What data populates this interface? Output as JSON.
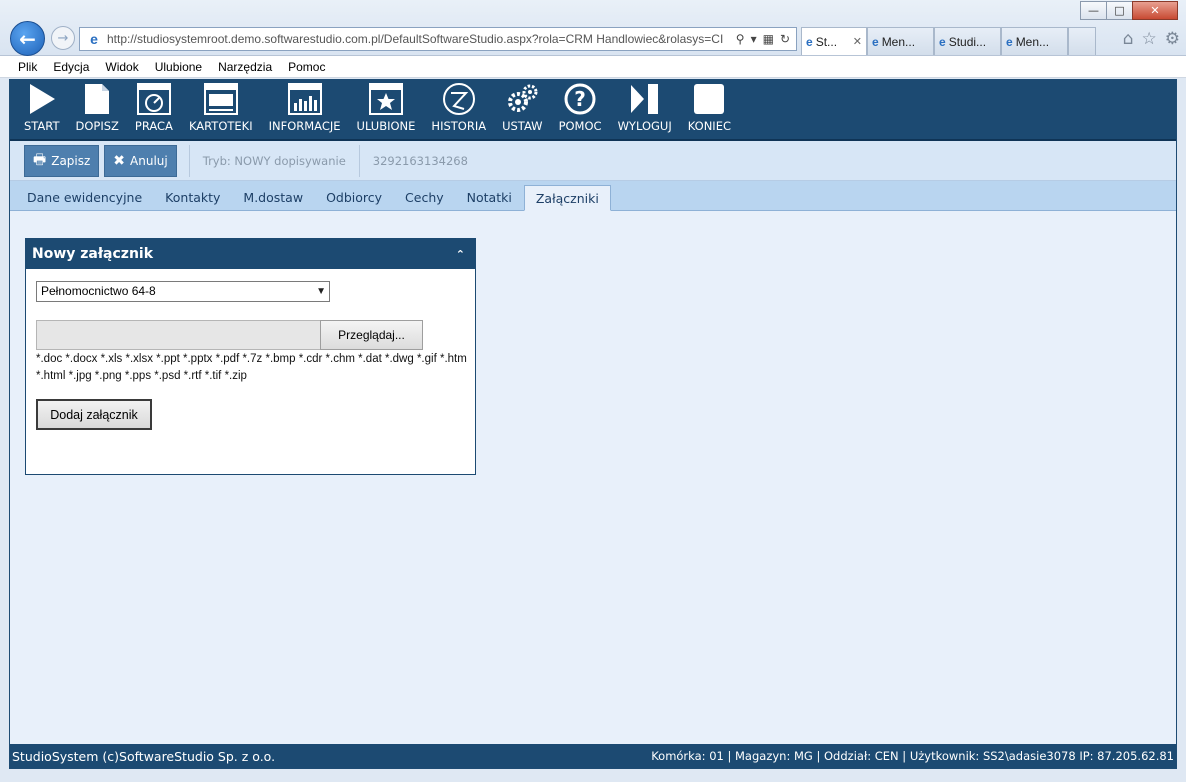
{
  "browser": {
    "url": "http://studiosystemroot.demo.softwarestudio.com.pl/DefaultSoftwareStudio.aspx?rola=CRM Handlowiec&rolasys=CI",
    "tabs": [
      {
        "label": "St...",
        "active": true
      },
      {
        "label": "Men...",
        "active": false
      },
      {
        "label": "Studi...",
        "active": false
      },
      {
        "label": "Men...",
        "active": false
      }
    ],
    "menu": [
      "Plik",
      "Edycja",
      "Widok",
      "Ulubione",
      "Narzędzia",
      "Pomoc"
    ]
  },
  "toolbar": {
    "items": [
      {
        "label": "START",
        "icon": "play-icon"
      },
      {
        "label": "DOPISZ",
        "icon": "document-icon"
      },
      {
        "label": "PRACA",
        "icon": "gauge-icon"
      },
      {
        "label": "KARTOTEKI",
        "icon": "window-icon"
      },
      {
        "label": "INFORMACJE",
        "icon": "chart-icon"
      },
      {
        "label": "ULUBIONE",
        "icon": "star-icon"
      },
      {
        "label": "HISTORIA",
        "icon": "history-icon"
      },
      {
        "label": "USTAW",
        "icon": "gears-icon"
      },
      {
        "label": "POMOC",
        "icon": "help-icon"
      },
      {
        "label": "WYLOGUJ",
        "icon": "logout-icon"
      },
      {
        "label": "KONIEC",
        "icon": "stop-icon"
      }
    ]
  },
  "actions": {
    "save_label": "Zapisz",
    "cancel_label": "Anuluj",
    "mode_text": "Tryb: NOWY dopisywanie",
    "record_id": "3292163134268"
  },
  "tabs": [
    {
      "label": "Dane ewidencyjne",
      "active": false
    },
    {
      "label": "Kontakty",
      "active": false
    },
    {
      "label": "M.dostaw",
      "active": false
    },
    {
      "label": "Odbiorcy",
      "active": false
    },
    {
      "label": "Cechy",
      "active": false
    },
    {
      "label": "Notatki",
      "active": false
    },
    {
      "label": "Załączniki",
      "active": true
    }
  ],
  "attachment_panel": {
    "title": "Nowy załącznik",
    "selected_type": "Pełnomocnictwo 64-8",
    "browse_label": "Przeglądaj...",
    "file_value": "",
    "extensions": "*.doc *.docx *.xls *.xlsx *.ppt *.pptx *.pdf *.7z *.bmp *.cdr *.chm *.dat *.dwg *.gif *.htm *.html *.jpg *.png *.pps *.psd *.rtf *.tif *.zip",
    "add_label": "Dodaj załącznik"
  },
  "status": {
    "left": "StudioSystem (c)SoftwareStudio Sp. z o.o.",
    "right": "Komórka: 01 | Magazyn: MG | Oddział: CEN | Użytkownik: SS2\\adasie3078 IP: 87.205.62.81"
  }
}
